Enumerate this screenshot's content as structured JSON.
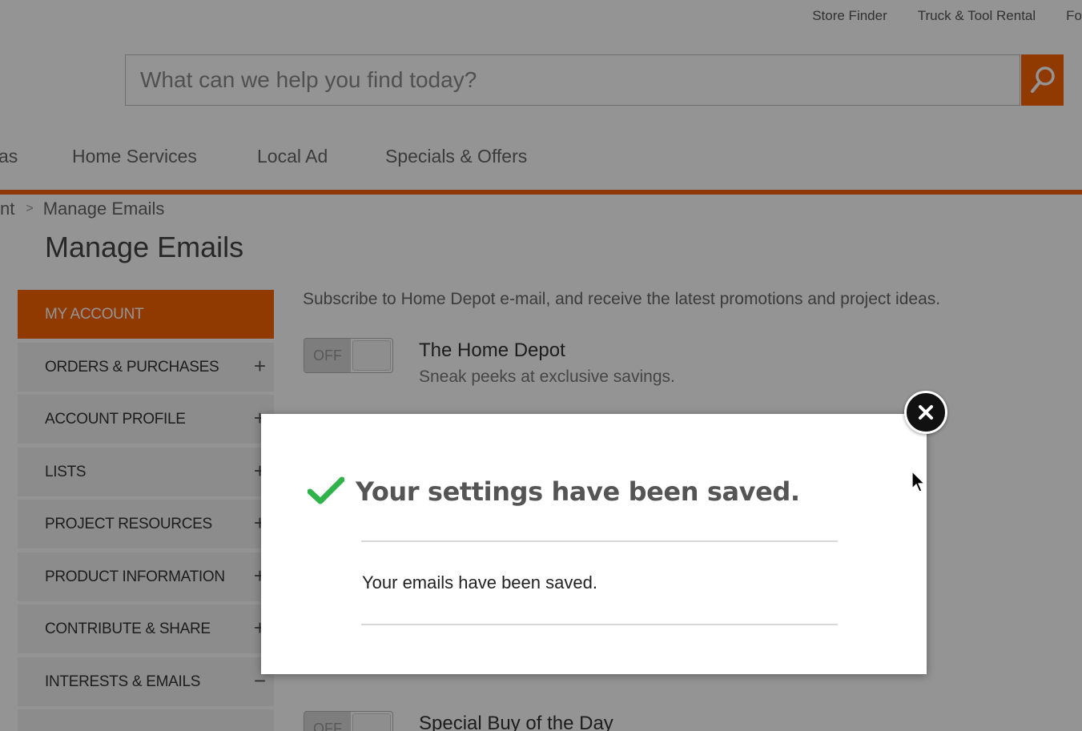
{
  "header": {
    "util_links": [
      "Store Finder",
      "Truck & Tool Rental",
      "Fo"
    ]
  },
  "search": {
    "placeholder": "What can we help you find today?",
    "button_icon": "search-icon"
  },
  "nav": {
    "items": [
      "as",
      "Home Services",
      "Local Ad",
      "Specials & Offers"
    ]
  },
  "breadcrumb": {
    "parent": "nt",
    "separator": ">",
    "current": "Manage Emails"
  },
  "page": {
    "title": "Manage Emails"
  },
  "sidebar": {
    "items": [
      {
        "label": "MY ACCOUNT",
        "toggle": ""
      },
      {
        "label": "ORDERS & PURCHASES",
        "toggle": "+"
      },
      {
        "label": "ACCOUNT PROFILE",
        "toggle": "+"
      },
      {
        "label": "LISTS",
        "toggle": "+"
      },
      {
        "label": "PROJECT RESOURCES",
        "toggle": "+"
      },
      {
        "label": "PRODUCT INFORMATION",
        "toggle": "+"
      },
      {
        "label": "CONTRIBUTE & SHARE",
        "toggle": "+"
      },
      {
        "label": "INTERESTS & EMAILS",
        "toggle": "−"
      }
    ]
  },
  "content": {
    "intro": "Subscribe to Home Depot e-mail, and receive the latest promotions and project ideas.",
    "subscriptions": [
      {
        "toggle_label": "OFF",
        "title": "The Home Depot",
        "description": "Sneak peeks at exclusive savings."
      },
      {
        "toggle_label": "OFF",
        "title": "Special Buy of the Day",
        "description": ""
      }
    ]
  },
  "modal": {
    "title": "Your settings have been saved.",
    "message": "Your emails have been saved.",
    "close_icon": "close-icon",
    "status_icon": "checkmark-icon"
  },
  "colors": {
    "brand_orange": "#f96302",
    "success_green": "#2fb34a",
    "overlay": "rgba(0,0,0,0.42)"
  }
}
